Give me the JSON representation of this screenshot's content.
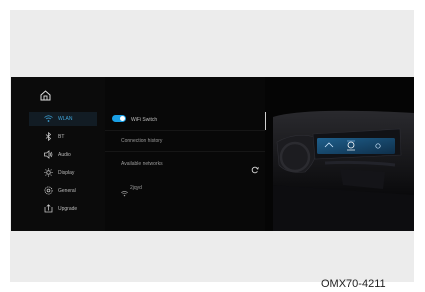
{
  "sidebar": {
    "home_icon": "home-icon",
    "items": [
      {
        "label": "WLAN",
        "icon": "wifi-icon",
        "active": true
      },
      {
        "label": "BT",
        "icon": "bluetooth-icon",
        "active": false
      },
      {
        "label": "Audio",
        "icon": "speaker-icon",
        "active": false
      },
      {
        "label": "Display",
        "icon": "sun-icon",
        "active": false
      },
      {
        "label": "General",
        "icon": "gear-icon",
        "active": false
      },
      {
        "label": "Upgrade",
        "icon": "upgrade-icon",
        "active": false
      }
    ]
  },
  "main": {
    "wifi_switch_label": "WiFi Switch",
    "wifi_switch_on": true,
    "connection_history_label": "Connection history",
    "available_networks_label": "Available networks",
    "network_name": "2jqyd"
  },
  "colors": {
    "accent": "#1aa0e6",
    "active_nav": "#3fa4d8",
    "screen_bg": "#050505"
  },
  "caption": "OMX70-4211"
}
